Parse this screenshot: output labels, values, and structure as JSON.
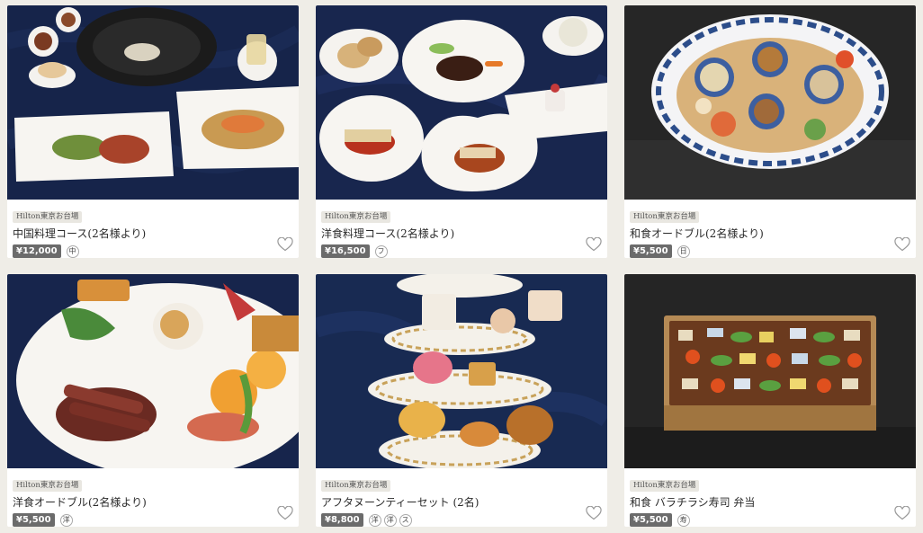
{
  "colors": {
    "background": "#efede7",
    "price_badge": "#6b6b6b",
    "store_badge": "#e9e7e1",
    "navy_tablecloth": "#16244a",
    "dark_tablecloth": "#2a2a2a"
  },
  "products": [
    {
      "store": "Hilton東京お台場",
      "title": "中国料理コース(2名様より)",
      "price": "¥12,000",
      "tags": [
        "中"
      ],
      "photo": "chinese-course-photo"
    },
    {
      "store": "Hilton東京お台場",
      "title": "洋食料理コース(2名様より)",
      "price": "¥16,500",
      "tags": [
        "フ"
      ],
      "photo": "western-course-photo"
    },
    {
      "store": "Hilton東京お台場",
      "title": "和食オードブル(2名様より)",
      "price": "¥5,500",
      "tags": [
        "日"
      ],
      "photo": "japanese-hors-doeuvre-photo"
    },
    {
      "store": "Hilton東京お台場",
      "title": "洋食オードブル(2名様より)",
      "price": "¥5,500",
      "tags": [
        "洋"
      ],
      "photo": "western-hors-doeuvre-photo"
    },
    {
      "store": "Hilton東京お台場",
      "title": "アフタヌーンティーセット (2名)",
      "price": "¥8,800",
      "tags": [
        "洋",
        "洋",
        "ス"
      ],
      "photo": "afternoon-tea-photo"
    },
    {
      "store": "Hilton東京お台場",
      "title": "和食 バラチラシ寿司 弁当",
      "price": "¥5,500",
      "tags": [
        "寿"
      ],
      "photo": "chirashi-bento-photo"
    }
  ]
}
